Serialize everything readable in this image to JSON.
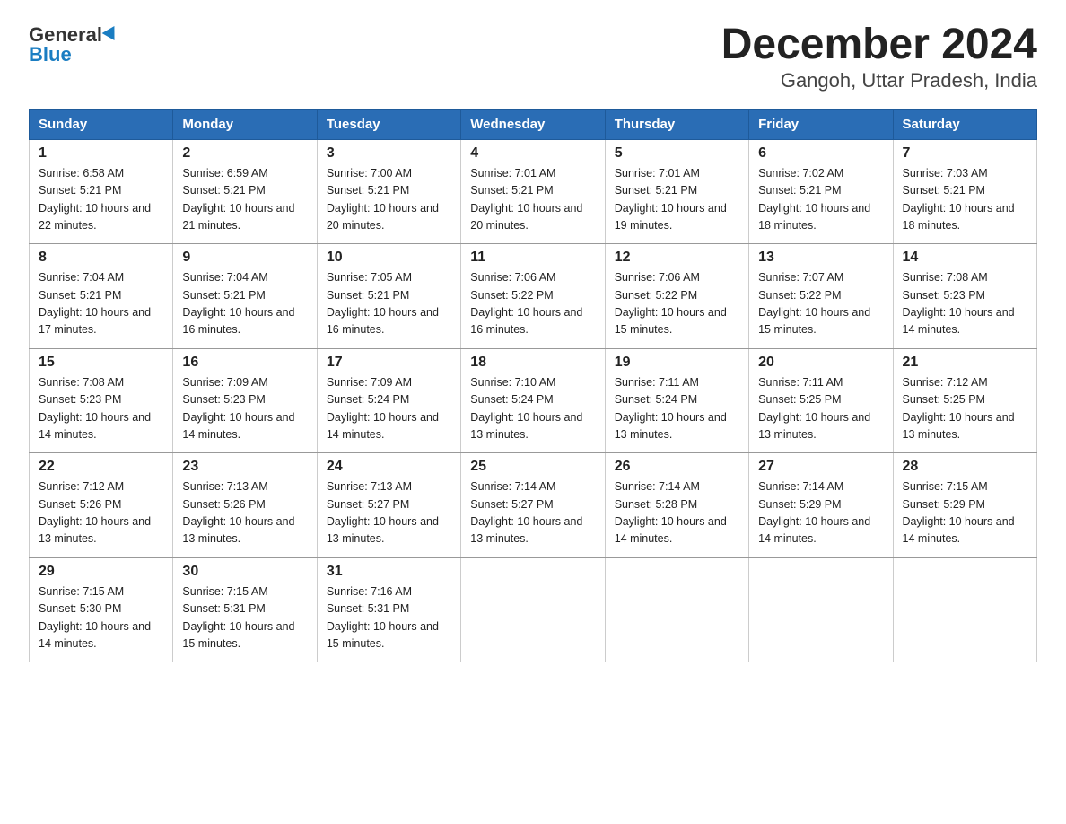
{
  "logo": {
    "general": "General",
    "blue": "Blue"
  },
  "title": "December 2024",
  "subtitle": "Gangoh, Uttar Pradesh, India",
  "days_of_week": [
    "Sunday",
    "Monday",
    "Tuesday",
    "Wednesday",
    "Thursday",
    "Friday",
    "Saturday"
  ],
  "weeks": [
    [
      {
        "day": "1",
        "sunrise": "6:58 AM",
        "sunset": "5:21 PM",
        "daylight": "10 hours and 22 minutes."
      },
      {
        "day": "2",
        "sunrise": "6:59 AM",
        "sunset": "5:21 PM",
        "daylight": "10 hours and 21 minutes."
      },
      {
        "day": "3",
        "sunrise": "7:00 AM",
        "sunset": "5:21 PM",
        "daylight": "10 hours and 20 minutes."
      },
      {
        "day": "4",
        "sunrise": "7:01 AM",
        "sunset": "5:21 PM",
        "daylight": "10 hours and 20 minutes."
      },
      {
        "day": "5",
        "sunrise": "7:01 AM",
        "sunset": "5:21 PM",
        "daylight": "10 hours and 19 minutes."
      },
      {
        "day": "6",
        "sunrise": "7:02 AM",
        "sunset": "5:21 PM",
        "daylight": "10 hours and 18 minutes."
      },
      {
        "day": "7",
        "sunrise": "7:03 AM",
        "sunset": "5:21 PM",
        "daylight": "10 hours and 18 minutes."
      }
    ],
    [
      {
        "day": "8",
        "sunrise": "7:04 AM",
        "sunset": "5:21 PM",
        "daylight": "10 hours and 17 minutes."
      },
      {
        "day": "9",
        "sunrise": "7:04 AM",
        "sunset": "5:21 PM",
        "daylight": "10 hours and 16 minutes."
      },
      {
        "day": "10",
        "sunrise": "7:05 AM",
        "sunset": "5:21 PM",
        "daylight": "10 hours and 16 minutes."
      },
      {
        "day": "11",
        "sunrise": "7:06 AM",
        "sunset": "5:22 PM",
        "daylight": "10 hours and 16 minutes."
      },
      {
        "day": "12",
        "sunrise": "7:06 AM",
        "sunset": "5:22 PM",
        "daylight": "10 hours and 15 minutes."
      },
      {
        "day": "13",
        "sunrise": "7:07 AM",
        "sunset": "5:22 PM",
        "daylight": "10 hours and 15 minutes."
      },
      {
        "day": "14",
        "sunrise": "7:08 AM",
        "sunset": "5:23 PM",
        "daylight": "10 hours and 14 minutes."
      }
    ],
    [
      {
        "day": "15",
        "sunrise": "7:08 AM",
        "sunset": "5:23 PM",
        "daylight": "10 hours and 14 minutes."
      },
      {
        "day": "16",
        "sunrise": "7:09 AM",
        "sunset": "5:23 PM",
        "daylight": "10 hours and 14 minutes."
      },
      {
        "day": "17",
        "sunrise": "7:09 AM",
        "sunset": "5:24 PM",
        "daylight": "10 hours and 14 minutes."
      },
      {
        "day": "18",
        "sunrise": "7:10 AM",
        "sunset": "5:24 PM",
        "daylight": "10 hours and 13 minutes."
      },
      {
        "day": "19",
        "sunrise": "7:11 AM",
        "sunset": "5:24 PM",
        "daylight": "10 hours and 13 minutes."
      },
      {
        "day": "20",
        "sunrise": "7:11 AM",
        "sunset": "5:25 PM",
        "daylight": "10 hours and 13 minutes."
      },
      {
        "day": "21",
        "sunrise": "7:12 AM",
        "sunset": "5:25 PM",
        "daylight": "10 hours and 13 minutes."
      }
    ],
    [
      {
        "day": "22",
        "sunrise": "7:12 AM",
        "sunset": "5:26 PM",
        "daylight": "10 hours and 13 minutes."
      },
      {
        "day": "23",
        "sunrise": "7:13 AM",
        "sunset": "5:26 PM",
        "daylight": "10 hours and 13 minutes."
      },
      {
        "day": "24",
        "sunrise": "7:13 AM",
        "sunset": "5:27 PM",
        "daylight": "10 hours and 13 minutes."
      },
      {
        "day": "25",
        "sunrise": "7:14 AM",
        "sunset": "5:27 PM",
        "daylight": "10 hours and 13 minutes."
      },
      {
        "day": "26",
        "sunrise": "7:14 AM",
        "sunset": "5:28 PM",
        "daylight": "10 hours and 14 minutes."
      },
      {
        "day": "27",
        "sunrise": "7:14 AM",
        "sunset": "5:29 PM",
        "daylight": "10 hours and 14 minutes."
      },
      {
        "day": "28",
        "sunrise": "7:15 AM",
        "sunset": "5:29 PM",
        "daylight": "10 hours and 14 minutes."
      }
    ],
    [
      {
        "day": "29",
        "sunrise": "7:15 AM",
        "sunset": "5:30 PM",
        "daylight": "10 hours and 14 minutes."
      },
      {
        "day": "30",
        "sunrise": "7:15 AM",
        "sunset": "5:31 PM",
        "daylight": "10 hours and 15 minutes."
      },
      {
        "day": "31",
        "sunrise": "7:16 AM",
        "sunset": "5:31 PM",
        "daylight": "10 hours and 15 minutes."
      },
      null,
      null,
      null,
      null
    ]
  ]
}
